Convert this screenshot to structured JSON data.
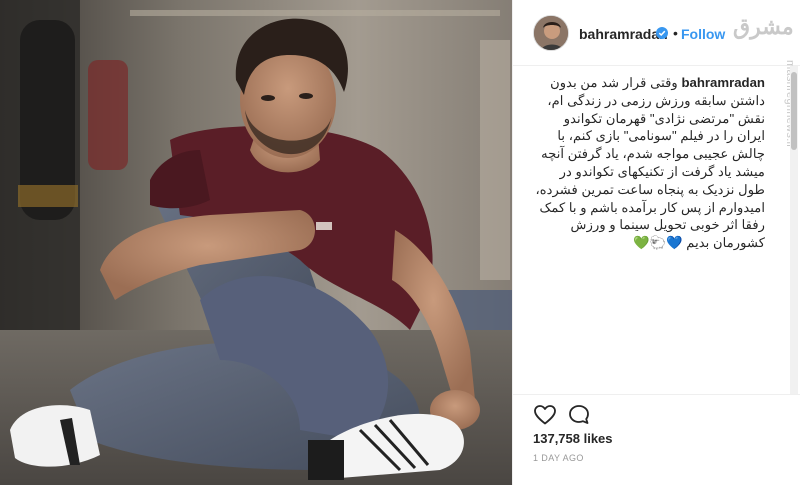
{
  "post": {
    "username": "bahramradan",
    "separator": "•",
    "follow_label": "Follow",
    "caption_user": "bahramradan",
    "caption_text": "وقتی قرار شد من بدون داشتن سابقه ورزش رزمی در زندگی ام، نقش \"مرتضی نژادی\" قهرمان تکواندو ایران را در فیلم \"سونامی\" بازی کنم، با چالش عجیبی مواجه شدم، یاد گرفتن آنچه میشد یاد گرفت از تکنیکهای تکواندو در طول نزدیک به پنجاه ساعت تمرین فشرده، امیدوارم از پس کار برآمده باشم و با کمک رفقا اثر خوبی تحویل سینما و ورزش کشورمان بدیم",
    "caption_emojis": "💚🐑💙",
    "likes": "137,758 likes",
    "timestamp": "1 DAY AGO"
  },
  "watermark": {
    "logo_text": "مشرق",
    "side_text": "mashreghnews.ir"
  },
  "icons": {
    "heart": "heart-icon",
    "comment": "comment-icon",
    "verified": "verified-badge-icon"
  },
  "colors": {
    "link": "#3897f0",
    "text": "#262626",
    "muted": "#999999",
    "shirt": "#5a1e27"
  }
}
